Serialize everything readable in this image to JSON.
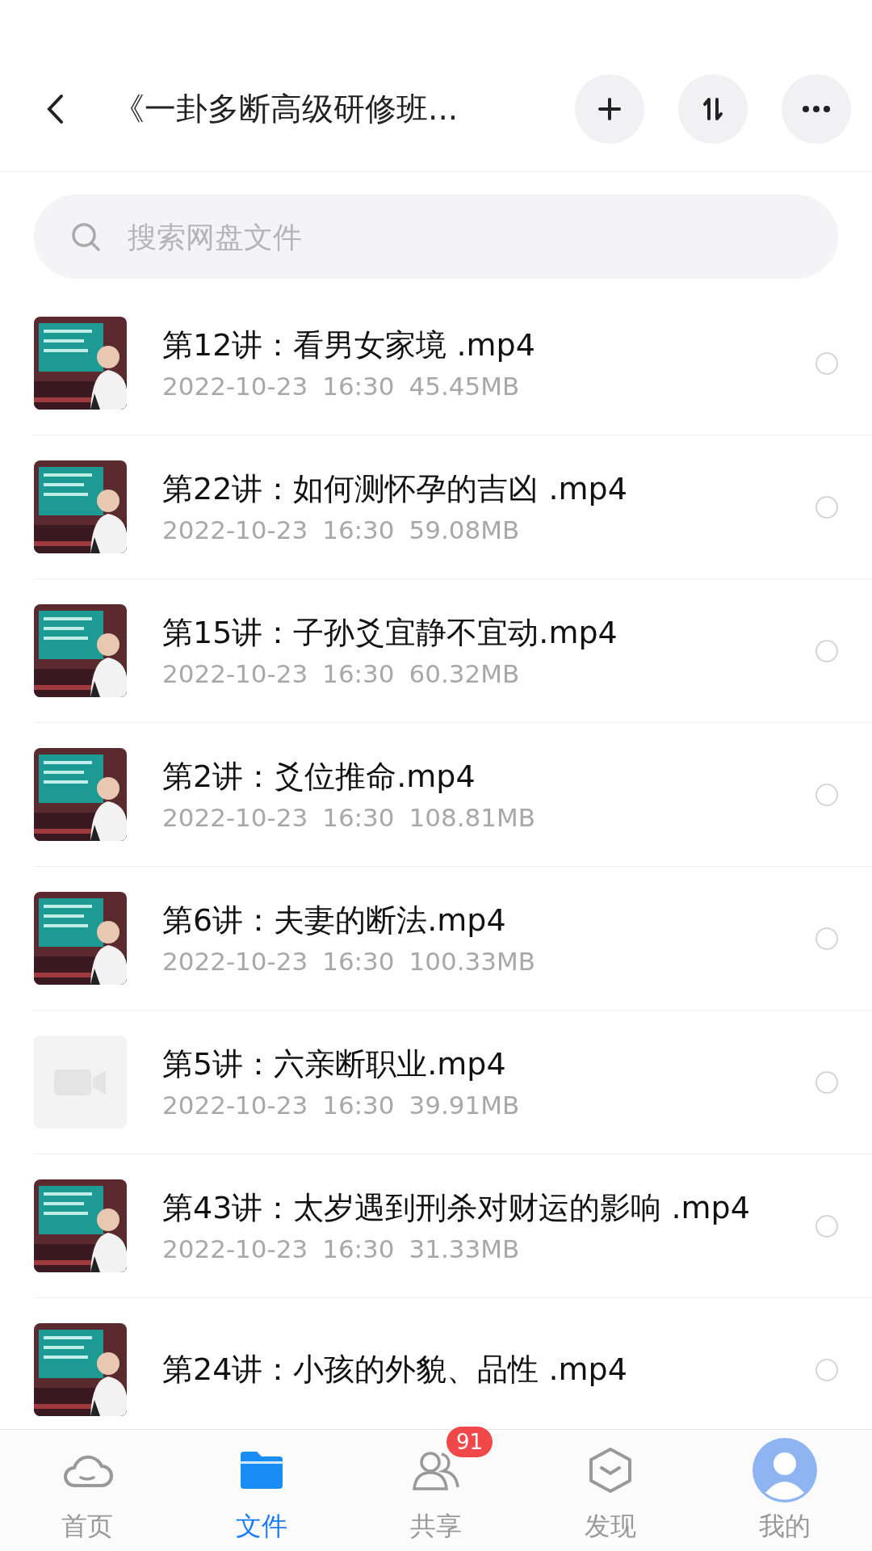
{
  "header": {
    "title": "《一卦多断高级研修班..."
  },
  "search": {
    "placeholder": "搜索网盘文件"
  },
  "files": [
    {
      "kind": "video",
      "name": "第12讲：看男女家境 .mp4",
      "date": "2022-10-23",
      "time": "16:30",
      "size": "45.45MB",
      "selected": false
    },
    {
      "kind": "video",
      "name": "第22讲：如何测怀孕的吉凶 .mp4",
      "date": "2022-10-23",
      "time": "16:30",
      "size": "59.08MB",
      "selected": false
    },
    {
      "kind": "video",
      "name": "第15讲：子孙爻宜静不宜动.mp4",
      "date": "2022-10-23",
      "time": "16:30",
      "size": "60.32MB",
      "selected": false
    },
    {
      "kind": "video",
      "name": "第2讲：爻位推命.mp4",
      "date": "2022-10-23",
      "time": "16:30",
      "size": "108.81MB",
      "selected": false
    },
    {
      "kind": "video",
      "name": "第6讲：夫妻的断法.mp4",
      "date": "2022-10-23",
      "time": "16:30",
      "size": "100.33MB",
      "selected": false
    },
    {
      "kind": "placeholder",
      "name": "第5讲：六亲断职业.mp4",
      "date": "2022-10-23",
      "time": "16:30",
      "size": "39.91MB",
      "selected": false
    },
    {
      "kind": "video",
      "name": "第43讲：太岁遇到刑杀对财运的影响 .mp4",
      "date": "2022-10-23",
      "time": "16:30",
      "size": "31.33MB",
      "selected": false
    },
    {
      "kind": "video",
      "name": "第24讲：小孩的外貌、品性 .mp4",
      "selected": false
    }
  ],
  "tabs": [
    {
      "kind": "home",
      "label": "首页",
      "selected": false
    },
    {
      "kind": "files",
      "label": "文件",
      "selected": true
    },
    {
      "kind": "share",
      "label": "共享",
      "selected": false,
      "badge": "91"
    },
    {
      "kind": "discover",
      "label": "发现",
      "selected": false
    },
    {
      "kind": "me",
      "label": "我的",
      "selected": false
    }
  ]
}
